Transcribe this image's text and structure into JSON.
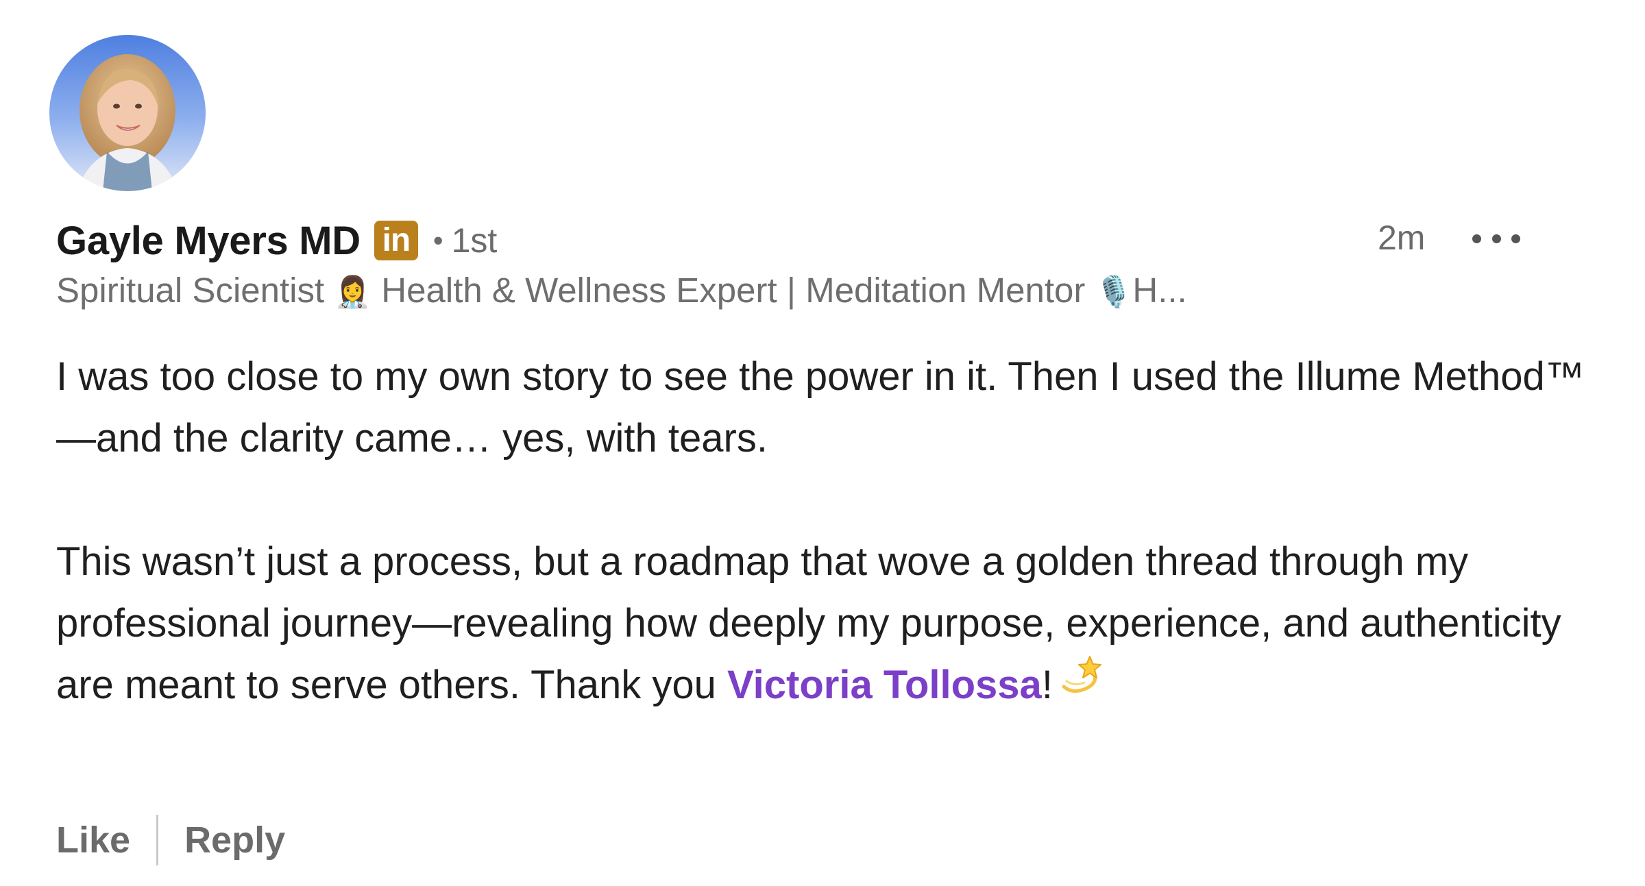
{
  "author": {
    "name": "Gayle Myers MD",
    "badge": "in",
    "separator": "•",
    "connection_degree": "1st",
    "headline_parts": {
      "part1": "Spiritual Scientist ",
      "emoji1": "👩‍⚕️",
      "part2": " Health & Wellness Expert | Meditation Mentor ",
      "emoji2": "🎙️",
      "part3": "H..."
    }
  },
  "comment": {
    "timestamp": "2m",
    "paragraph1": "I was too close to my own story to see the power in it. Then I used the Illume Method™—and the clarity came… yes, with tears.",
    "paragraph2_text": "This wasn’t just a process, but a roadmap that wove a golden thread through my professional journey—revealing how deeply my purpose, experience, and authenticity are meant to serve others. Thank you ",
    "mention": "Victoria Tollossa",
    "paragraph2_end": "!",
    "end_emoji": "dizzy-star"
  },
  "actions": {
    "like_label": "Like",
    "reply_label": "Reply"
  },
  "colors": {
    "mention": "#7b3fc8",
    "badge_bg": "#b9801b",
    "secondary_text": "#6b6b6b"
  }
}
